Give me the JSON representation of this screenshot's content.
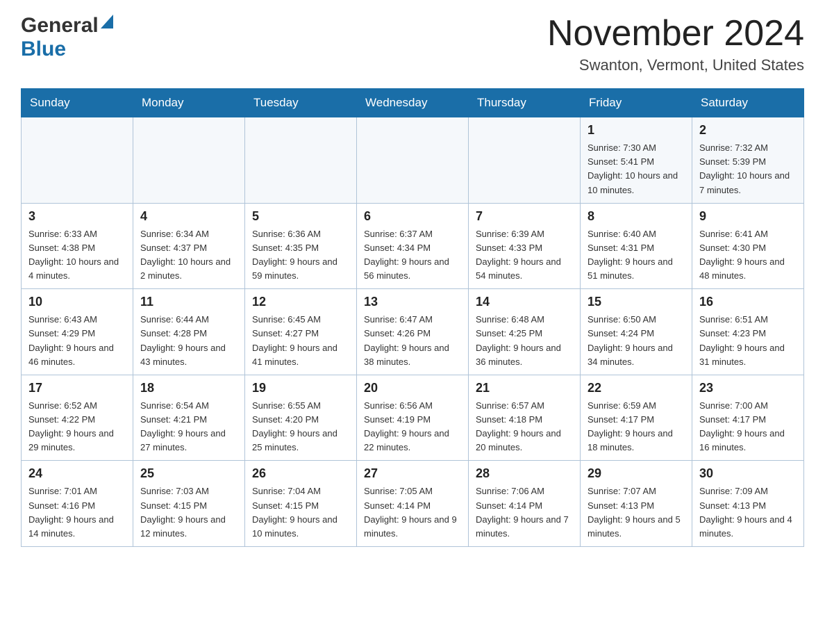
{
  "logo": {
    "general": "General",
    "blue": "Blue"
  },
  "header": {
    "month_year": "November 2024",
    "location": "Swanton, Vermont, United States"
  },
  "weekdays": [
    "Sunday",
    "Monday",
    "Tuesday",
    "Wednesday",
    "Thursday",
    "Friday",
    "Saturday"
  ],
  "weeks": [
    [
      {
        "day": "",
        "info": ""
      },
      {
        "day": "",
        "info": ""
      },
      {
        "day": "",
        "info": ""
      },
      {
        "day": "",
        "info": ""
      },
      {
        "day": "",
        "info": ""
      },
      {
        "day": "1",
        "info": "Sunrise: 7:30 AM\nSunset: 5:41 PM\nDaylight: 10 hours and 10 minutes."
      },
      {
        "day": "2",
        "info": "Sunrise: 7:32 AM\nSunset: 5:39 PM\nDaylight: 10 hours and 7 minutes."
      }
    ],
    [
      {
        "day": "3",
        "info": "Sunrise: 6:33 AM\nSunset: 4:38 PM\nDaylight: 10 hours and 4 minutes."
      },
      {
        "day": "4",
        "info": "Sunrise: 6:34 AM\nSunset: 4:37 PM\nDaylight: 10 hours and 2 minutes."
      },
      {
        "day": "5",
        "info": "Sunrise: 6:36 AM\nSunset: 4:35 PM\nDaylight: 9 hours and 59 minutes."
      },
      {
        "day": "6",
        "info": "Sunrise: 6:37 AM\nSunset: 4:34 PM\nDaylight: 9 hours and 56 minutes."
      },
      {
        "day": "7",
        "info": "Sunrise: 6:39 AM\nSunset: 4:33 PM\nDaylight: 9 hours and 54 minutes."
      },
      {
        "day": "8",
        "info": "Sunrise: 6:40 AM\nSunset: 4:31 PM\nDaylight: 9 hours and 51 minutes."
      },
      {
        "day": "9",
        "info": "Sunrise: 6:41 AM\nSunset: 4:30 PM\nDaylight: 9 hours and 48 minutes."
      }
    ],
    [
      {
        "day": "10",
        "info": "Sunrise: 6:43 AM\nSunset: 4:29 PM\nDaylight: 9 hours and 46 minutes."
      },
      {
        "day": "11",
        "info": "Sunrise: 6:44 AM\nSunset: 4:28 PM\nDaylight: 9 hours and 43 minutes."
      },
      {
        "day": "12",
        "info": "Sunrise: 6:45 AM\nSunset: 4:27 PM\nDaylight: 9 hours and 41 minutes."
      },
      {
        "day": "13",
        "info": "Sunrise: 6:47 AM\nSunset: 4:26 PM\nDaylight: 9 hours and 38 minutes."
      },
      {
        "day": "14",
        "info": "Sunrise: 6:48 AM\nSunset: 4:25 PM\nDaylight: 9 hours and 36 minutes."
      },
      {
        "day": "15",
        "info": "Sunrise: 6:50 AM\nSunset: 4:24 PM\nDaylight: 9 hours and 34 minutes."
      },
      {
        "day": "16",
        "info": "Sunrise: 6:51 AM\nSunset: 4:23 PM\nDaylight: 9 hours and 31 minutes."
      }
    ],
    [
      {
        "day": "17",
        "info": "Sunrise: 6:52 AM\nSunset: 4:22 PM\nDaylight: 9 hours and 29 minutes."
      },
      {
        "day": "18",
        "info": "Sunrise: 6:54 AM\nSunset: 4:21 PM\nDaylight: 9 hours and 27 minutes."
      },
      {
        "day": "19",
        "info": "Sunrise: 6:55 AM\nSunset: 4:20 PM\nDaylight: 9 hours and 25 minutes."
      },
      {
        "day": "20",
        "info": "Sunrise: 6:56 AM\nSunset: 4:19 PM\nDaylight: 9 hours and 22 minutes."
      },
      {
        "day": "21",
        "info": "Sunrise: 6:57 AM\nSunset: 4:18 PM\nDaylight: 9 hours and 20 minutes."
      },
      {
        "day": "22",
        "info": "Sunrise: 6:59 AM\nSunset: 4:17 PM\nDaylight: 9 hours and 18 minutes."
      },
      {
        "day": "23",
        "info": "Sunrise: 7:00 AM\nSunset: 4:17 PM\nDaylight: 9 hours and 16 minutes."
      }
    ],
    [
      {
        "day": "24",
        "info": "Sunrise: 7:01 AM\nSunset: 4:16 PM\nDaylight: 9 hours and 14 minutes."
      },
      {
        "day": "25",
        "info": "Sunrise: 7:03 AM\nSunset: 4:15 PM\nDaylight: 9 hours and 12 minutes."
      },
      {
        "day": "26",
        "info": "Sunrise: 7:04 AM\nSunset: 4:15 PM\nDaylight: 9 hours and 10 minutes."
      },
      {
        "day": "27",
        "info": "Sunrise: 7:05 AM\nSunset: 4:14 PM\nDaylight: 9 hours and 9 minutes."
      },
      {
        "day": "28",
        "info": "Sunrise: 7:06 AM\nSunset: 4:14 PM\nDaylight: 9 hours and 7 minutes."
      },
      {
        "day": "29",
        "info": "Sunrise: 7:07 AM\nSunset: 4:13 PM\nDaylight: 9 hours and 5 minutes."
      },
      {
        "day": "30",
        "info": "Sunrise: 7:09 AM\nSunset: 4:13 PM\nDaylight: 9 hours and 4 minutes."
      }
    ]
  ]
}
